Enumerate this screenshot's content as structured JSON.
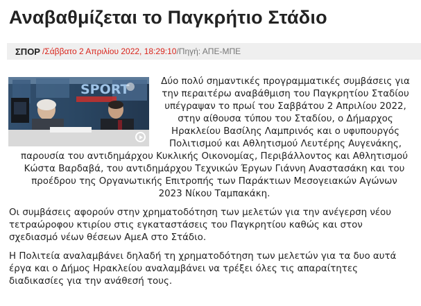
{
  "article": {
    "title": "Αναβαθμίζεται το Παγκρήτιο Στάδιο",
    "meta": {
      "section": "ΣΠΟΡ",
      "date": " /Σάββατο 2 Απριλίου 2022, 18:29:10",
      "separator": " / ",
      "source": "Πηγή: ΑΠΕ-ΜΠΕ"
    },
    "photo": {
      "banner_text": "SPORT"
    },
    "paragraph1_lines": [
      "Δύο πολύ σημαντικές προγραμματικές συμβάσεις για",
      "την περαιτέρω αναβάθμιση του Παγκρητίου Σταδίου",
      "υπέγραψαν το πρωί του Σαββάτου 2 Απριλίου 2022,",
      "στην αίθουσα τύπου του Σταδίου, ο Δήμαρχος",
      "Ηρακλείου Βασίλης Λαμπρινός και ο υφυπουργός",
      "Πολιτισμού και Αθλητισμού Λευτέρης Αυγενάκης,",
      "παρουσία του αντιδημάρχου Κυκλικής Οικονομίας, Περιβάλλοντος και Αθλητισμού",
      "Κώστα Βαρδαβά, του αντιδημάρχου Τεχνικών Έργων Γιάννη Αναστασάκη και του",
      "προέδρου της Οργανωτικής Επιτροπής των Παράκτιων Μεσογειακών Αγώνων",
      "2023 Νίκου Ταμπακάκη."
    ],
    "paragraph2_lines": [
      "Οι συμβάσεις αφορούν  στην χρηματοδότηση των μελετών για την ανέγερση νέου",
      "τετραώροφου κτιρίου στις εγκαταστάσεις του Παγκρητίου καθώς και στον",
      "σχεδιασμό νέων θέσεων ΑμεΑ στο Στάδιο."
    ],
    "paragraph3_lines": [
      "Η Πολιτεία αναλαμβάνει δηλαδή τη χρηματοδότηση των μελετών για τα δυο αυτά",
      "έργα και ο Δήμος Ηρακλείου αναλαμβάνει να τρέξει όλες τις απαραίτητες",
      "διαδικασίες για την ανάθεσή τους."
    ]
  },
  "colors": {
    "date_red": "#d9251c",
    "meta_bg": "#efefef",
    "text": "#222222"
  }
}
